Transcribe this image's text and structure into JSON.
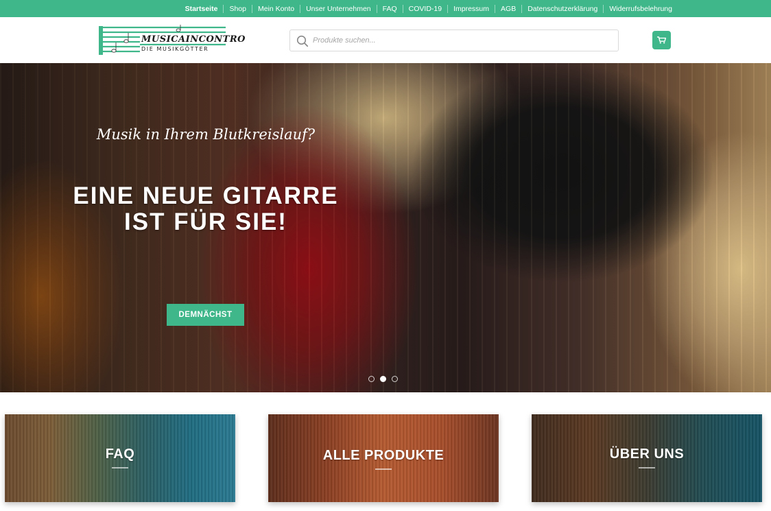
{
  "topnav": {
    "items": [
      "Startseite",
      "Shop",
      "Mein Konto",
      "Unser Unternehmen",
      "FAQ",
      "COVID-19",
      "Impressum",
      "AGB",
      "Datenschutzerklärung",
      "Widerrufsbelehrung"
    ]
  },
  "logo": {
    "name": "MUSICAINCONTRO",
    "tagline": "DIE MUSIKGÖTTER"
  },
  "search": {
    "placeholder": "Produkte suchen..."
  },
  "hero": {
    "subtitle": "Musik in Ihrem Blutkreislauf?",
    "title": "EINE NEUE GITARRE IST FÜR SIE!",
    "button": "DEMNÄCHST",
    "slides": 3,
    "active_slide": 2
  },
  "tiles": [
    {
      "label": "FAQ"
    },
    {
      "label": "ALLE PRODUKTE"
    },
    {
      "label": "ÜBER UNS"
    }
  ],
  "colors": {
    "accent": "#3fb78a"
  }
}
